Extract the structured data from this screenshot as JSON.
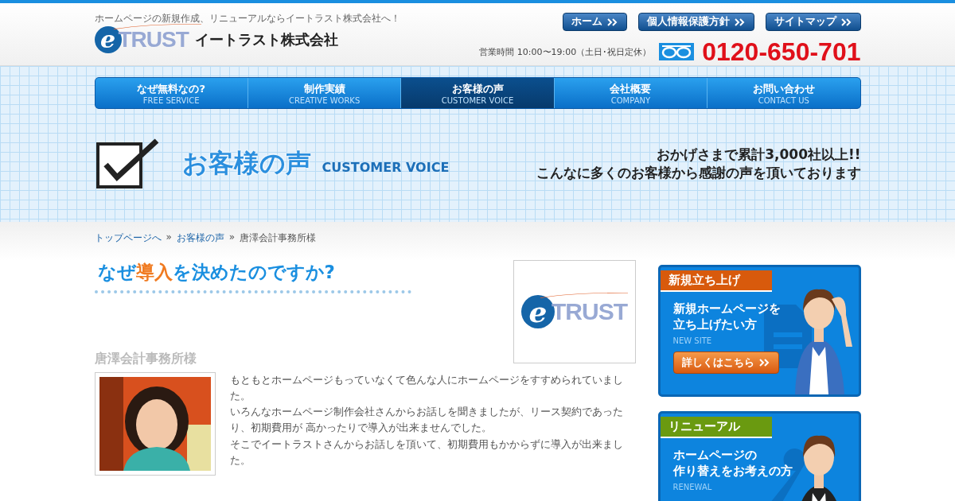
{
  "header": {
    "tagline": "ホームページの新規作成、リニューアルならイートラスト株式会社へ！",
    "logo": {
      "letter": "e",
      "word": "TRUST"
    },
    "company_name": "イートラスト株式会社",
    "top_links": [
      "ホーム",
      "個人情報保護方針",
      "サイトマップ"
    ],
    "business_hours": "営業時間 10:00〜19:00（土日･祝日定休）",
    "phone": "0120-650-701"
  },
  "nav": [
    {
      "label": "なぜ無料なの?",
      "sublabel": "FREE SERVICE",
      "selected": false
    },
    {
      "label": "制作実績",
      "sublabel": "CREATIVE WORKS",
      "selected": false
    },
    {
      "label": "お客様の声",
      "sublabel": "CUSTOMER VOICE",
      "selected": true
    },
    {
      "label": "会社概要",
      "sublabel": "COMPANY",
      "selected": false
    },
    {
      "label": "お問い合わせ",
      "sublabel": "CONTACT US",
      "selected": false
    }
  ],
  "hero": {
    "title": "お客様の声",
    "subtitle": "CUSTOMER VOICE",
    "message": [
      "おかげさまで累計3,000社以上!!",
      "こんなに多くのお客様から感謝の声を頂いております"
    ]
  },
  "breadcrumb": {
    "separator": "»",
    "items": [
      {
        "label": "トップページへ",
        "kind": "link"
      },
      {
        "label": "お客様の声",
        "kind": "link"
      },
      {
        "label": "唐澤会計事務所様",
        "kind": "current"
      }
    ]
  },
  "article": {
    "heading": [
      {
        "text": "なぜ",
        "accent": false
      },
      {
        "text": "導入",
        "accent": true
      },
      {
        "text": "を決めたのですか?",
        "accent": false
      }
    ],
    "logo": {
      "letter": "e",
      "word": "TRUST"
    },
    "client_name": "唐澤会計事務所様",
    "paragraphs": [
      "もともとホームページもっていなくて色んな人にホームページをすすめられていました。",
      "いろんなホームページ制作会社さんからお話しを聞きましたが、リース契約であったり、初期費用が 高かったりで導入が出来ませんでした。",
      "そこでイートラストさんからお話しを頂いて、初期費用もかからずに導入が出来ました。"
    ]
  },
  "sidebar": [
    {
      "kind": "new",
      "ribbon": "新規立ち上げ",
      "color": "#d85a0c",
      "title": [
        "新規ホームページを",
        "立ち上げたい方"
      ],
      "subtitle": "NEW SITE",
      "button": "詳しくはこちら"
    },
    {
      "kind": "renewal",
      "ribbon": "リニューアル",
      "color": "#6a9a10",
      "title": [
        "ホームページの",
        "作り替えをお考えの方"
      ],
      "subtitle": "RENEWAL"
    }
  ]
}
